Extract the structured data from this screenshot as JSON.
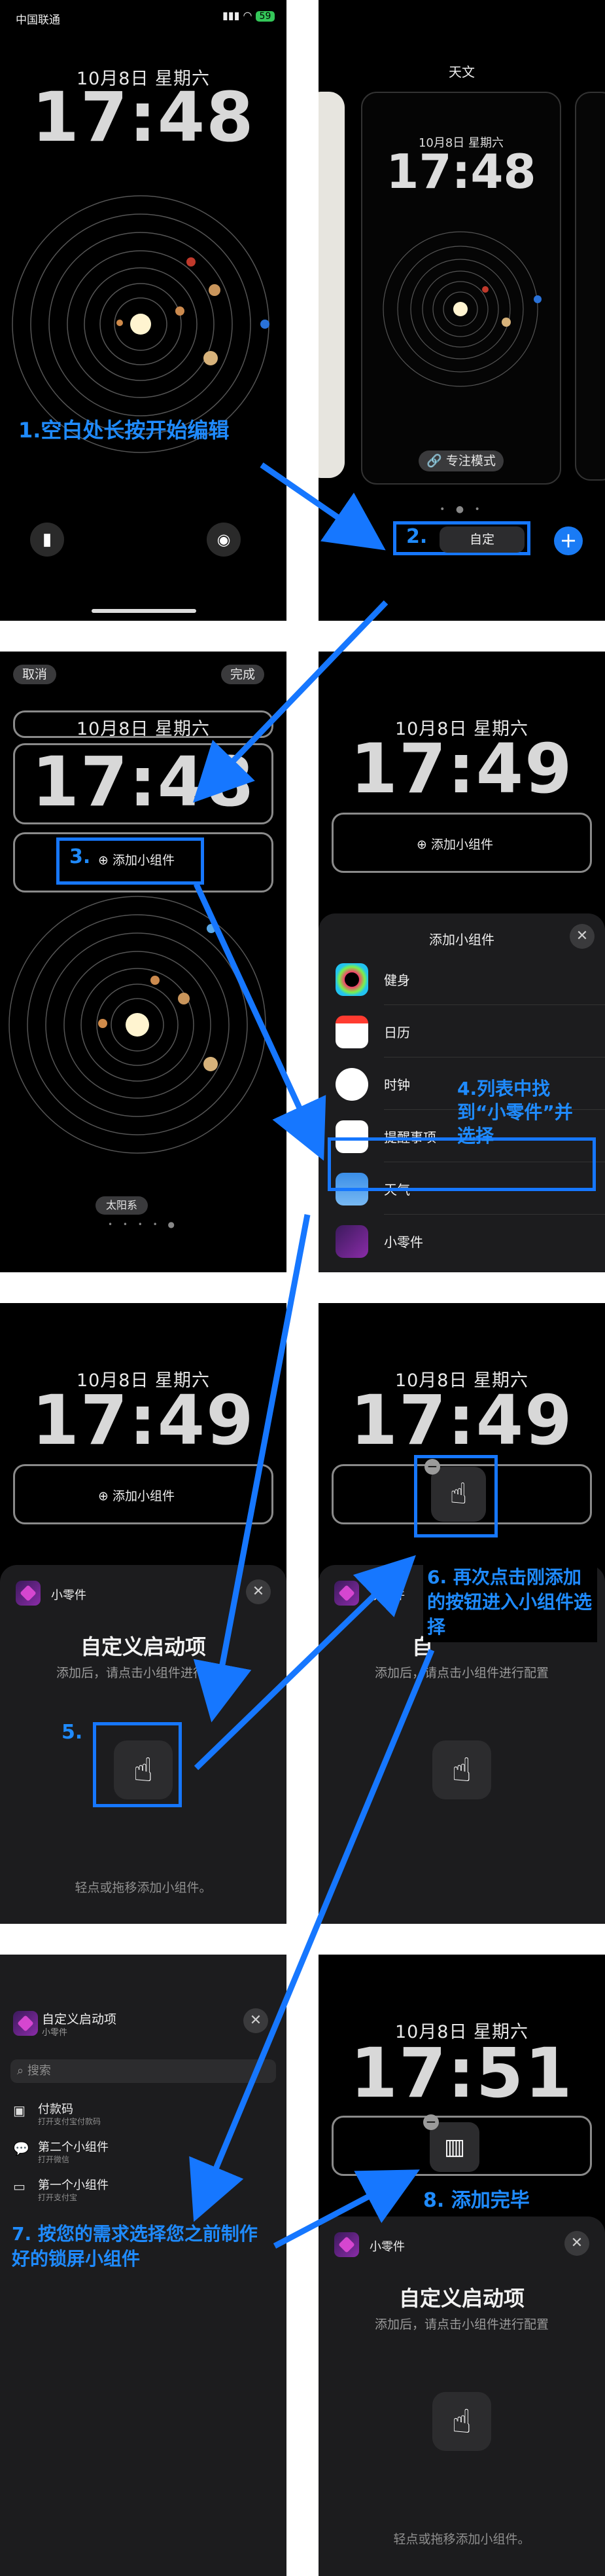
{
  "colors": {
    "annotation": "#1f8bff",
    "highlight_box": "#1677ff",
    "sheet_bg": "#1c1c1e"
  },
  "panel1": {
    "carrier": "中国联通",
    "battery": "59",
    "date": "10月8日 星期六",
    "time": "17:48",
    "annotation": "1.空白处长按开始编辑",
    "icons": [
      "flashlight-icon",
      "camera-icon"
    ]
  },
  "panel2": {
    "header": "天文",
    "date": "10月8日 星期六",
    "time": "17:48",
    "focus_label": "专注模式",
    "customize_label": "自定",
    "step_label": "2.",
    "add_icon": "plus-icon"
  },
  "panel3": {
    "cancel": "取消",
    "done": "完成",
    "date": "10月8日 星期六",
    "time": "17:48",
    "add_widget": "添加小组件",
    "step_label": "3.",
    "badge": "太阳系"
  },
  "panel4": {
    "date": "10月8日 星期六",
    "time": "17:49",
    "add_widget": "添加小组件",
    "sheet_title": "添加小组件",
    "list": [
      "健身",
      "日历",
      "时钟",
      "提醒事项",
      "天气",
      "小零件"
    ],
    "annotation": "4.列表中找到“小零件”并选择"
  },
  "panel5": {
    "date": "10月8日 星期六",
    "time": "17:49",
    "add_widget": "添加小组件",
    "app_name": "小零件",
    "title": "自定义启动项",
    "subtitle": "添加后，请点击小组件进行配置",
    "footer": "轻点或拖移添加小组件。",
    "step_label": "5."
  },
  "panel6": {
    "date": "10月8日 星期六",
    "time": "17:49",
    "app_name": "小零件",
    "title_partial": "自",
    "subtitle": "添加后，请点击小组件进行配置",
    "annotation": "6. 再次点击刚添加的按钮进入小组件选择"
  },
  "panel7": {
    "title": "自定义启动项",
    "app_name": "小零件",
    "search_placeholder": "搜索",
    "items": [
      {
        "title": "付款码",
        "sub": "打开支付宝付款码"
      },
      {
        "title": "第二个小组件",
        "sub": "打开微信"
      },
      {
        "title": "第一个小组件",
        "sub": "打开支付宝"
      }
    ],
    "annotation": "7. 按您的需求选择您之前制作好的锁屏小组件"
  },
  "panel8": {
    "date": "10月8日 星期六",
    "time": "17:51",
    "annotation": "8. 添加完毕",
    "app_name": "小零件",
    "title": "自定义启动项",
    "subtitle": "添加后，请点击小组件进行配置",
    "footer": "轻点或拖移添加小组件。"
  }
}
